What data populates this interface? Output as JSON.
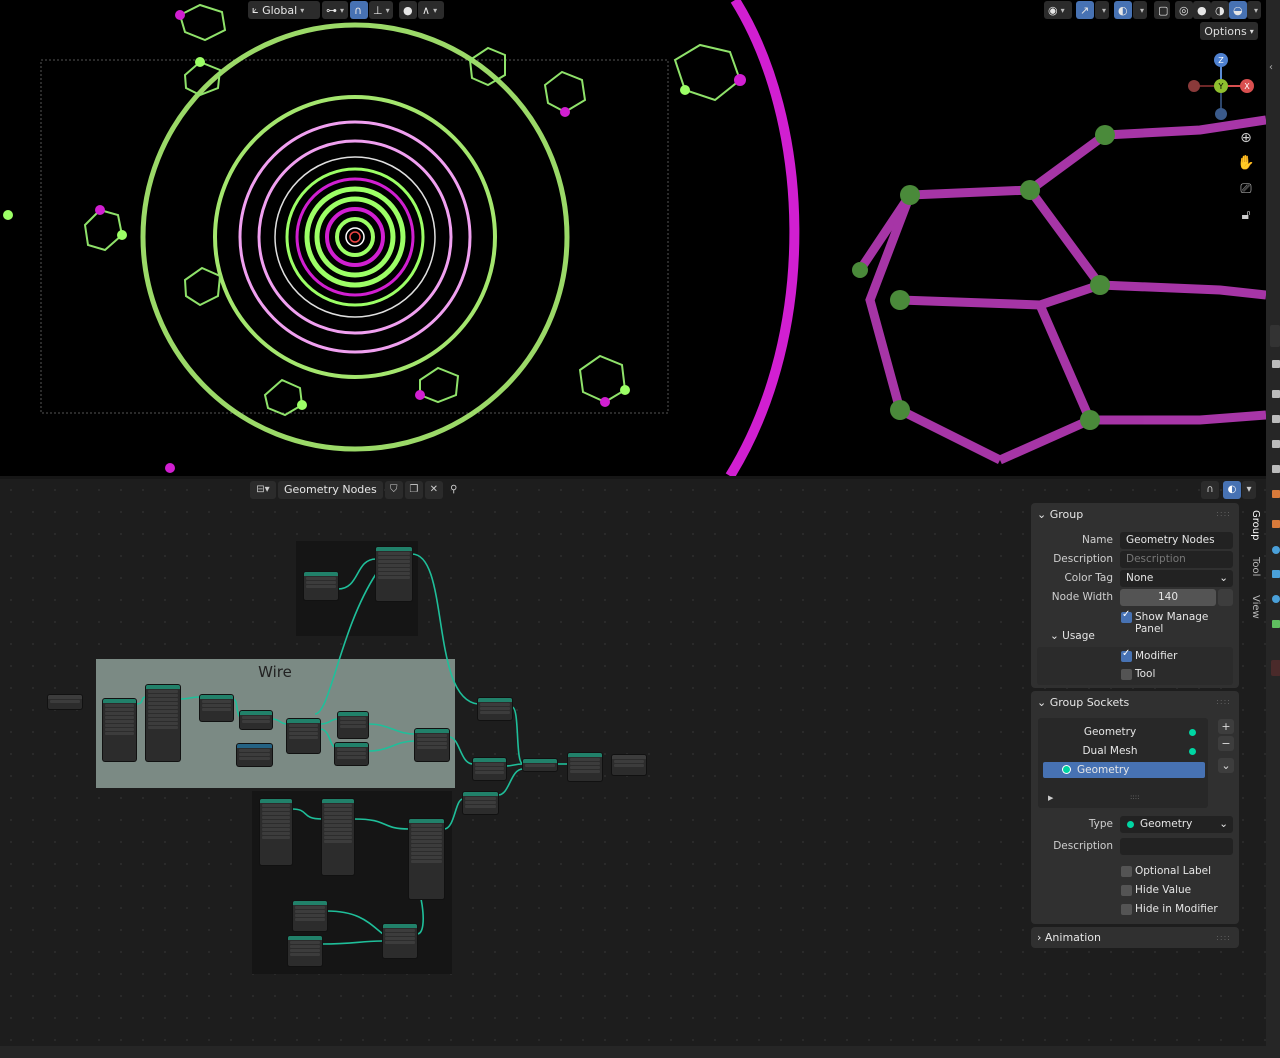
{
  "viewport_header": {
    "transform_orientation": "Global",
    "options_label": "Options"
  },
  "gizmo": {
    "z": "Z",
    "y": "Y",
    "x": "X"
  },
  "node_editor": {
    "tree_name": "Geometry Nodes",
    "frame_label": "Wire"
  },
  "sidebar": {
    "tabs": [
      "Group",
      "Tool",
      "View"
    ],
    "group_panel": {
      "title": "Group",
      "name_label": "Name",
      "name_value": "Geometry Nodes",
      "description_label": "Description",
      "description_placeholder": "Description",
      "color_tag_label": "Color Tag",
      "color_tag_value": "None",
      "node_width_label": "Node Width",
      "node_width_value": "140",
      "show_manage_panel": "Show Manage Panel",
      "usage_title": "Usage",
      "modifier_label": "Modifier",
      "tool_label": "Tool"
    },
    "group_sockets_panel": {
      "title": "Group Sockets",
      "sockets": [
        "Geometry",
        "Dual Mesh",
        "Geometry"
      ],
      "type_label": "Type",
      "type_value": "Geometry",
      "description_label": "Description",
      "optional_label": "Optional Label",
      "hide_value": "Hide Value",
      "hide_in_modifier": "Hide in Modifier"
    },
    "animation_panel": {
      "title": "Animation"
    }
  },
  "colors": {
    "accent_blue": "#4772b3",
    "socket_geometry": "#00d6a3",
    "node_header_geometry": "#21816a",
    "link": "#1fbf9a",
    "wire_frame": "#7b8a84",
    "viewport_green": "#9cff66",
    "viewport_magenta": "#d11fd1"
  }
}
